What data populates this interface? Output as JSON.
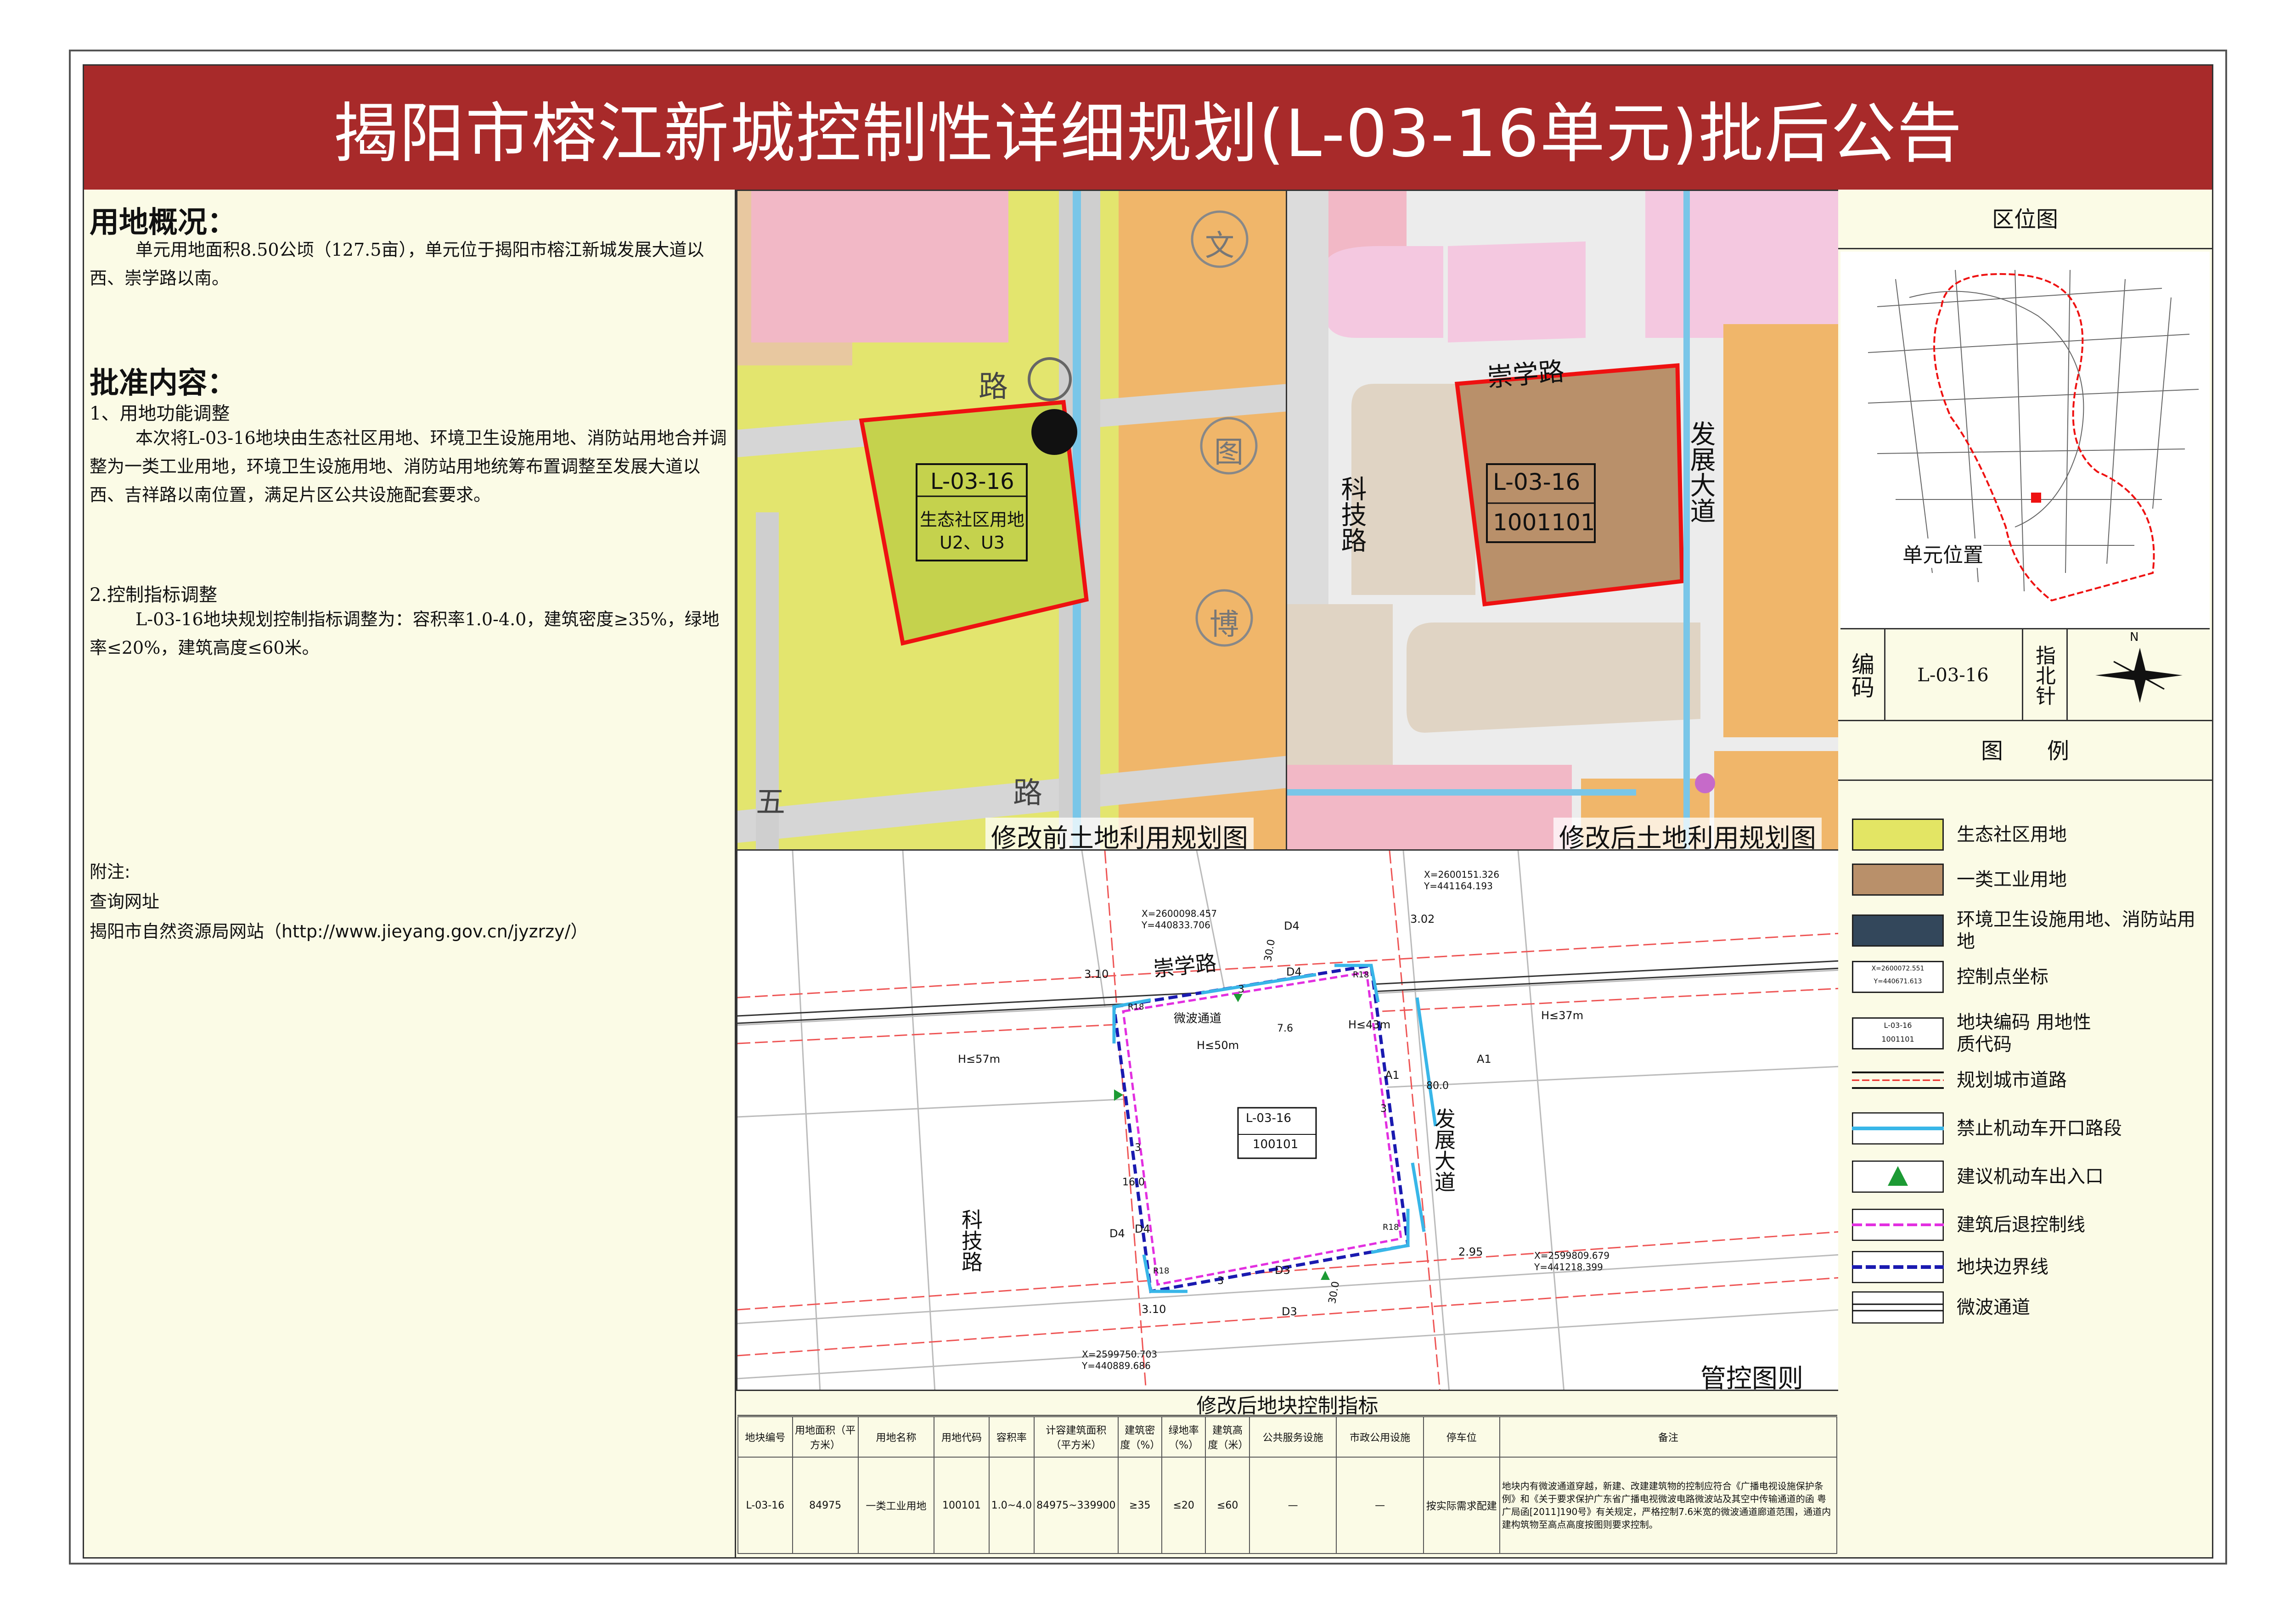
{
  "title": "揭阳市榕江新城控制性详细规划(L-03-16单元)批后公告",
  "overview": {
    "heading": "用地概况：",
    "text": "单元用地面积8.50公顷（127.5亩），单元位于揭阳市榕江新城发展大道以西、崇学路以南。"
  },
  "approval": {
    "heading": "批准内容：",
    "item1_title": "1、用地功能调整",
    "item1_text": "本次将L-03-16地块由生态社区用地、环境卫生设施用地、消防站用地合并调整为一类工业用地，环境卫生设施用地、消防站用地统筹布置调整至发展大道以西、吉祥路以南位置，满足片区公共设施配套要求。",
    "item2_title": "2.控制指标调整",
    "item2_text": "L-03-16地块规划控制指标调整为：容积率1.0-4.0，建筑密度≥35%，绿地率≤20%，建筑高度≤60米。"
  },
  "note": {
    "label": "附注:",
    "query": "查询网址",
    "site": "揭阳市自然资源局网站（http://www.jieyang.gov.cn/jyzrzy/）"
  },
  "map_before": {
    "caption": "修改前土地利用规划图",
    "parcel_code": "L-03-16",
    "parcel_use": "生态社区用地",
    "parcel_use_code": "U2、U3",
    "labels": [
      "路",
      "五",
      "路",
      "文",
      "图",
      "博"
    ]
  },
  "map_after": {
    "caption": "修改后土地利用规划图",
    "parcel_code": "L-03-16",
    "parcel_use_code": "1001101",
    "road_north": "崇学路",
    "road_east": "发展大道",
    "road_west": "科技路"
  },
  "control_map": {
    "caption": "管控图则",
    "parcel_code": "L-03-16",
    "parcel_use_code": "100101",
    "road_north": "崇学路",
    "road_east": "发展大道",
    "road_west": "科技路",
    "microwave": "微波通道",
    "coords": {
      "nw": [
        "X=2600098.457",
        "Y=440833.706"
      ],
      "ne": [
        "X=2600151.326",
        "Y=441164.193"
      ],
      "se": [
        "X=2599809.679",
        "Y=441218.399"
      ],
      "sw": [
        "X=2599750.703",
        "Y=440889.686"
      ]
    },
    "heights": [
      "H≤57m",
      "H≤50m",
      "H≤43m",
      "H≤37m"
    ],
    "dims": [
      "80.0",
      "30.0",
      "16.0",
      "30.0",
      "7.6"
    ],
    "elev": [
      "3.10",
      "3.02",
      "2.95",
      "3.10"
    ],
    "setbacks": [
      "3",
      "3",
      "3",
      "3"
    ],
    "radius": [
      "R18",
      "R18",
      "R18",
      "R18"
    ],
    "lines": [
      "A1",
      "A1",
      "D4",
      "D4",
      "D3",
      "D3",
      "D4",
      "D4"
    ]
  },
  "location": {
    "heading": "区位图",
    "marker_label": "单元位置"
  },
  "code_box": {
    "code_label": "编码",
    "code_value": "L-03-16",
    "north_label": "指北针",
    "north_n": "N"
  },
  "legend": {
    "heading": "图　　例",
    "items": [
      {
        "label": "生态社区用地",
        "color": "#e3e564"
      },
      {
        "label": "一类工业用地",
        "color": "#b9906a"
      },
      {
        "label": "环境卫生设施用地、消防站用地",
        "color": "#33475b"
      },
      {
        "label": "控制点坐标",
        "sample1": "X=2600072.551",
        "sample2": "Y=440671.613"
      },
      {
        "label": "地块编码 用地性质代码",
        "sample1": "L-03-16",
        "sample2": "1001101"
      },
      {
        "label": "规划城市道路"
      },
      {
        "label": "禁止机动车开口路段"
      },
      {
        "label": "建议机动车出入口"
      },
      {
        "label": "建筑后退控制线"
      },
      {
        "label": "地块边界线"
      },
      {
        "label": "微波通道"
      }
    ]
  },
  "table": {
    "title": "修改后地块控制指标",
    "headers": [
      "地块编号",
      "用地面积（平方米）",
      "用地名称",
      "用地代码",
      "容积率",
      "计容建筑面积（平方米）",
      "建筑密度（%）",
      "绿地率（%）",
      "建筑高度（米）",
      "公共服务设施",
      "市政公用设施",
      "停车位",
      "备注"
    ],
    "row": [
      "L-03-16",
      "84975",
      "一类工业用地",
      "100101",
      "1.0~4.0",
      "84975~339900",
      "≥35",
      "≤20",
      "≤60",
      "—",
      "—",
      "按实际需求配建",
      "地块内有微波通道穿越，新建、改建建筑物的控制应符合《广播电视设施保护条例》和《关于要求保护广东省广播电视微波电路微波站及其空中传输通道的函 粤广局函[2011]190号》有关规定，严格控制7.6米宽的微波通道廊道范围，通道内建构筑物至高点高度按图则要求控制。"
    ]
  }
}
